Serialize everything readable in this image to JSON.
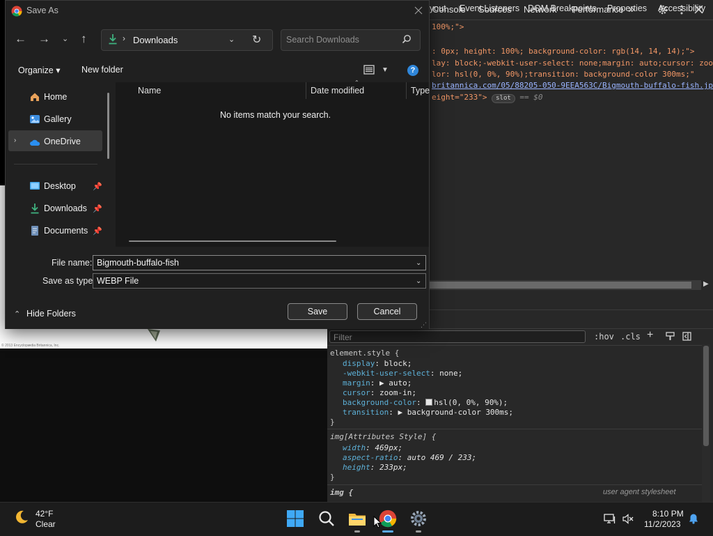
{
  "devtools": {
    "tabs": [
      "Console",
      "Sources",
      "Network",
      "Performance"
    ],
    "more_tabs": "»",
    "code_lines": [
      {
        "text": "100%;\">"
      },
      {
        "text": ": 0px; height: 100%; background-color: rgb(14, 14, 14);\">"
      },
      {
        "text": "lay: block;-webkit-user-select: none;margin: auto;cursor: zoom"
      },
      {
        "text": "lor: hsl(0, 0%, 90%);transition: background-color 300ms;\""
      },
      {
        "text": "britannica.com/05/88205-050-9EEA563C/Bigmouth-buffalo-fish.jp"
      },
      {
        "text": "eight=\"233\">"
      }
    ],
    "slot_badge": "slot",
    "dollar_zero": "== $0",
    "subtabs": [
      "yout",
      "Event Listeners",
      "DOM Breakpoints",
      "Properties",
      "Accessibility"
    ],
    "filter_placeholder": "Filter",
    "hov": ":hov",
    "cls": ".cls",
    "styles": {
      "element_style": "element.style {",
      "display": {
        "prop": "display",
        "value": "block;"
      },
      "user_select": {
        "prop": "-webkit-user-select",
        "value": "none;"
      },
      "margin": {
        "prop": "margin",
        "value": "▶ auto;"
      },
      "cursor": {
        "prop": "cursor",
        "value": "zoom-in;"
      },
      "bg": {
        "prop": "background-color",
        "value": "hsl(0, 0%, 90%);"
      },
      "transition": {
        "prop": "transition",
        "value": "▶ background-color 300ms;"
      },
      "close1": "}",
      "attr_selector": "img[Attributes Style] {",
      "width": {
        "prop": "width",
        "value": "469px;"
      },
      "aspect": {
        "prop": "aspect-ratio",
        "value": "auto 469 / 233;"
      },
      "height": {
        "prop": "height",
        "value": "233px;"
      },
      "close2": "}",
      "img_selector": "img {",
      "ua_stylesheet": "user agent stylesheet"
    }
  },
  "webpage": {
    "caption": "© 2013 Encyclopædia Britannica, Inc."
  },
  "dialog": {
    "title": "Save As",
    "address": {
      "location": "Downloads",
      "separator": "›"
    },
    "search_placeholder": "Search Downloads",
    "organize": "Organize ▾",
    "new_folder": "New folder",
    "nav": {
      "home": "Home",
      "gallery": "Gallery",
      "onedrive": "OneDrive",
      "desktop": "Desktop",
      "downloads": "Downloads",
      "documents": "Documents"
    },
    "columns": {
      "name": "Name",
      "date_modified": "Date modified",
      "type": "Type"
    },
    "empty_message": "No items match your search.",
    "file_name_label": "File name:",
    "file_name_value": "Bigmouth-buffalo-fish",
    "save_type_label": "Save as type:",
    "save_type_value": "WEBP File",
    "hide_folders": "Hide Folders",
    "save_button": "Save",
    "cancel_button": "Cancel"
  },
  "taskbar": {
    "weather_temp": "42°F",
    "weather_desc": "Clear",
    "time": "8:10 PM",
    "date": "11/2/2023"
  }
}
